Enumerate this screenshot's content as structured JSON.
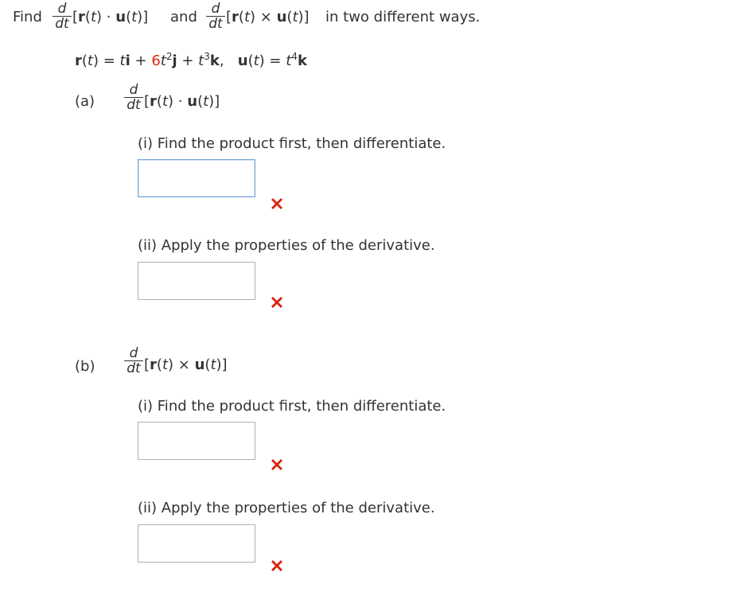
{
  "question": {
    "find_label": "Find",
    "d_symbol": "d",
    "dt_symbol": "dt",
    "dot_expr_open": "[",
    "r_of_t": "r",
    "u_of_t": "u",
    "t_var": "t",
    "dot_op": "·",
    "cross_op": "×",
    "and_label": "and",
    "suffix": "in two different ways."
  },
  "functions": {
    "r_lhs": "r",
    "u_lhs": "u",
    "r_coef_j": "6",
    "r_exp_j": "2",
    "r_exp_k": "3",
    "u_exp_k": "4"
  },
  "parts": [
    {
      "label": "(a)",
      "operator": "·",
      "sub_i_text": "(i) Find the product first, then differentiate.",
      "sub_ii_text": "(ii) Apply the properties of the derivative.",
      "answer_i": "",
      "answer_ii": ""
    },
    {
      "label": "(b)",
      "operator": "×",
      "sub_i_text": "(i) Find the product first, then differentiate.",
      "sub_ii_text": "(ii) Apply the properties of the derivative.",
      "answer_i": "",
      "answer_ii": ""
    }
  ],
  "colors": {
    "text": "#333333",
    "highlight": "#d9230f",
    "incorrect_mark": "#d9230f",
    "input_border": "#b0b0b0",
    "input_focus_border": "#7aa7d6"
  },
  "icons": {
    "status": "incorrect-x-icon"
  }
}
